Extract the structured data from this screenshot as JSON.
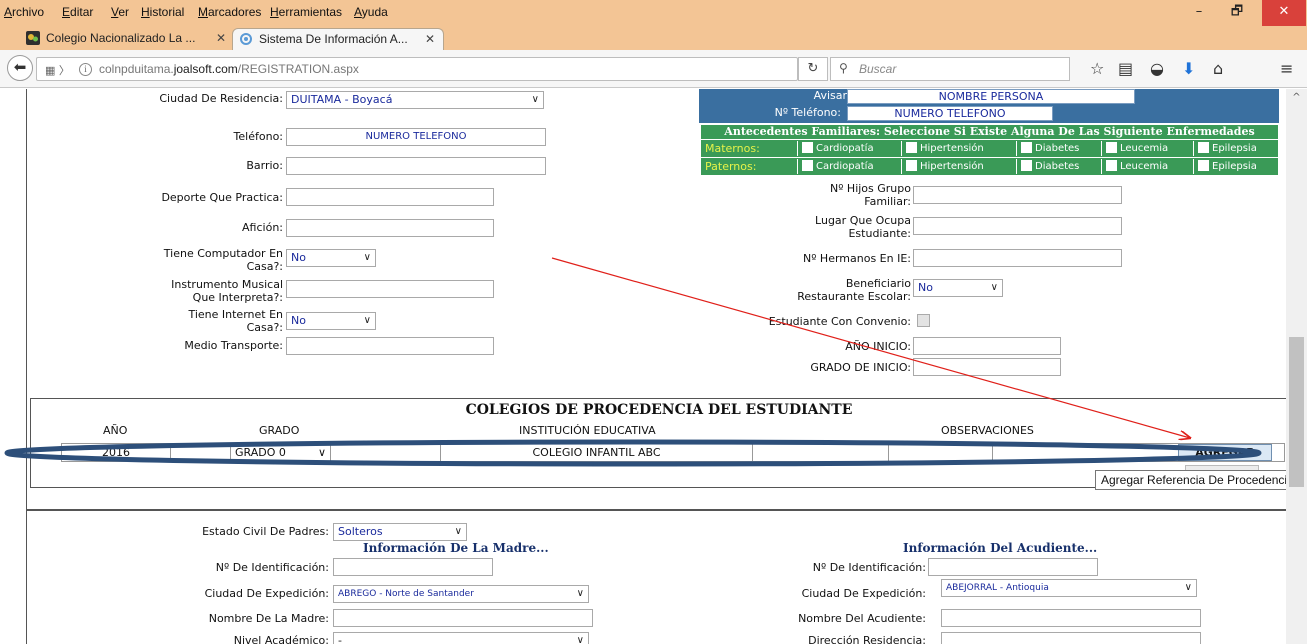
{
  "menubar": {
    "items": [
      "Archivo",
      "Editar",
      "Ver",
      "Historial",
      "Marcadores",
      "Herramientas",
      "Ayuda"
    ]
  },
  "window": {
    "minimize": "–",
    "restore": "🗗",
    "close": "✕"
  },
  "tabs": [
    {
      "title": "Colegio Nacionalizado La ...",
      "active": false
    },
    {
      "title": "Sistema De Información A...",
      "active": true
    }
  ],
  "newtab": "+",
  "navbar": {
    "url_prefix": "colnpduitama.",
    "url_domain": "joalsoft.com",
    "url_path": "/REGISTRATION.aspx",
    "search_placeholder": "Buscar",
    "reload": "↻"
  },
  "left_form": {
    "ciudad_residencia": {
      "label": "Ciudad De Residencia:",
      "value": "DUITAMA - Boyacá"
    },
    "telefono": {
      "label": "Teléfono:",
      "value": "NUMERO TELEFONO"
    },
    "barrio": {
      "label": "Barrio:",
      "value": ""
    },
    "deporte": {
      "label": "Deporte Que Practica:",
      "value": ""
    },
    "aficion": {
      "label": "Afición:",
      "value": ""
    },
    "computador": {
      "label_1": "Tiene Computador En",
      "label_2": "Casa?:",
      "value": "No"
    },
    "instrumento": {
      "label_1": "Instrumento Musical",
      "label_2": "Que Interpreta?:",
      "value": ""
    },
    "internet": {
      "label_1": "Tiene Internet En",
      "label_2": "Casa?:",
      "value": "No"
    },
    "transporte": {
      "label": "Medio Transporte:",
      "value": ""
    }
  },
  "avisar": {
    "label": "Avisar a:",
    "value": "NOMBRE PERSONA",
    "tel_label": "Nº Teléfono:",
    "tel_value": "NUMERO TELEFONO"
  },
  "antecedentes": {
    "title": "Antecedentes Familiares: Seleccione Si Existe Alguna De Las Siguiente Enfermedades",
    "rows": [
      {
        "label": "Maternos:",
        "items": [
          "Cardiopatía",
          "Hipertensión",
          "Diabetes",
          "Leucemia",
          "Epilepsia"
        ]
      },
      {
        "label": "Paternos:",
        "items": [
          "Cardiopatía",
          "Hipertensión",
          "Diabetes",
          "Leucemia",
          "Epilepsia"
        ]
      }
    ]
  },
  "right_form": {
    "hijos": {
      "label_1": "Nº Hijos Grupo",
      "label_2": "Familiar:",
      "value": ""
    },
    "lugar": {
      "label_1": "Lugar Que Ocupa",
      "label_2": "Estudiante:",
      "value": ""
    },
    "hermanos": {
      "label": "Nº Hermanos En IE:",
      "value": ""
    },
    "beneficiario": {
      "label_1": "Beneficiario",
      "label_2": "Restaurante Escolar:",
      "value": "No"
    },
    "convenio": {
      "label": "Estudiante Con Convenio:"
    },
    "anio_inicio": {
      "label": "AÑO INICIO:",
      "value": ""
    },
    "grado_inicio": {
      "label": "GRADO DE INICIO:",
      "value": ""
    }
  },
  "colegios": {
    "title": "COLEGIOS DE PROCEDENCIA DEL ESTUDIANTE",
    "headers": [
      "AÑO",
      "GRADO",
      "INSTITUCIÓN EDUCATIVA",
      "OBSERVACIONES"
    ],
    "row": {
      "anio": "2016",
      "grado": "GRADO 0",
      "institucion": "COLEGIO INFANTIL ABC",
      "observaciones": ""
    },
    "agregar_label": "AGREGAR",
    "tooltip": "Agregar Referencia De Procedencia."
  },
  "familia": {
    "estado_civil": {
      "label": "Estado Civil De Padres:",
      "value": "Solteros"
    },
    "madre": {
      "title": "Información De La Madre...",
      "identificacion_label": "Nº De Identificación:",
      "identificacion": "",
      "expedicion_label": "Ciudad De Expedición:",
      "expedicion": "ABREGO - Norte de Santander",
      "nombre_label": "Nombre De La Madre:",
      "nombre": "",
      "nivel_label": "Nivel Académico:",
      "nivel": "-"
    },
    "acudiente": {
      "title": "Información Del Acudiente...",
      "identificacion_label": "Nº De Identificación:",
      "identificacion": "",
      "expedicion_label": "Ciudad De Expedición:",
      "expedicion": "ABEJORRAL - Antioquia",
      "nombre_label": "Nombre Del Acudiente:",
      "nombre": "",
      "direccion_label": "Dirección Residencia:",
      "direccion": ""
    }
  },
  "annotation": {
    "color": "#e0201a",
    "ellipse_color": "#2d4f7a"
  }
}
